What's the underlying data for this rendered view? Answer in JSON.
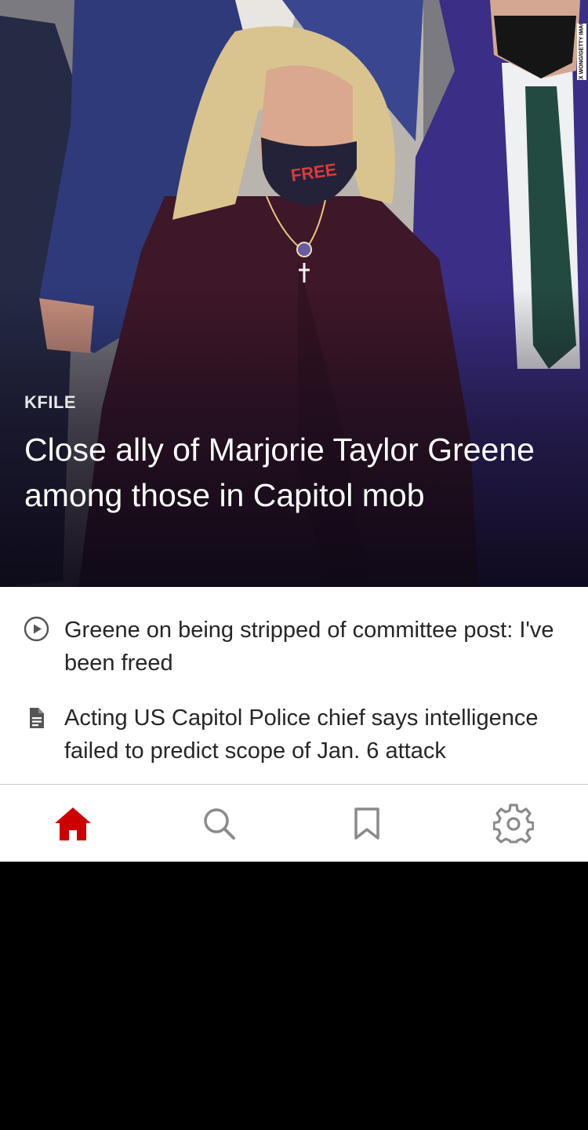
{
  "hero": {
    "kicker": "KFILE",
    "headline": "Close ally of Marjorie Taylor Greene among those in Capitol mob",
    "photo_credit": "ALEX WONG/GETTY IMAGES",
    "mask_text": "FREE SPEECH"
  },
  "related": [
    {
      "icon": "play-circle-icon",
      "text": "Greene on being stripped of committee post: I've been freed"
    },
    {
      "icon": "document-icon",
      "text": "Acting US Capitol Police chief says intelligence failed to predict scope of Jan. 6 attack"
    }
  ],
  "tabs": [
    {
      "name": "home",
      "icon": "home-icon",
      "active": true
    },
    {
      "name": "search",
      "icon": "search-icon",
      "active": false
    },
    {
      "name": "saved",
      "icon": "bookmark-icon",
      "active": false
    },
    {
      "name": "settings",
      "icon": "gear-icon",
      "active": false
    }
  ],
  "colors": {
    "accent": "#cc0000",
    "inactive_icon": "#8a8a8a",
    "text": "#262626"
  }
}
